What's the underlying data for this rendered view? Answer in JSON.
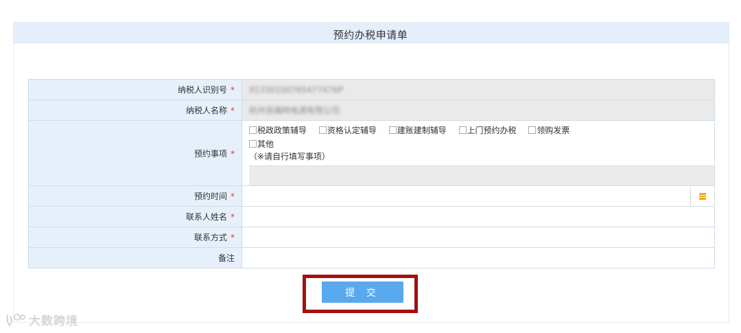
{
  "form": {
    "title": "预约办税申请单",
    "required_mark": "*",
    "fields": {
      "taxpayer_id": {
        "label": "纳税人识别号",
        "value": "91330100765477476P"
      },
      "taxpayer_name": {
        "label": "纳税人名称",
        "value": "杭州浙瀚特电源有限公司"
      },
      "appointment_items": {
        "label": "预约事项",
        "options": [
          "税政政策辅导",
          "资格认定辅导",
          "建账建制辅导",
          "上门预约办税",
          "领购发票",
          "其他"
        ],
        "other_hint": "（※请自行填写事项）"
      },
      "appointment_time": {
        "label": "预约时间",
        "value": "",
        "icon": "calendar-icon"
      },
      "contact_name": {
        "label": "联系人姓名",
        "value": ""
      },
      "contact_method": {
        "label": "联系方式",
        "value": ""
      },
      "remarks": {
        "label": "备注",
        "value": ""
      }
    },
    "submit_label": "提 交"
  },
  "watermark": {
    "text": "大数跨境"
  },
  "colors": {
    "header_band": "#e4effb",
    "label_bg": "#e6f0fb",
    "readonly_bg": "#eaeaea",
    "required": "#ee3333",
    "submit_bg": "#58a9ee",
    "highlight_border": "#a21010",
    "calendar_icon": "#e8a91a"
  }
}
